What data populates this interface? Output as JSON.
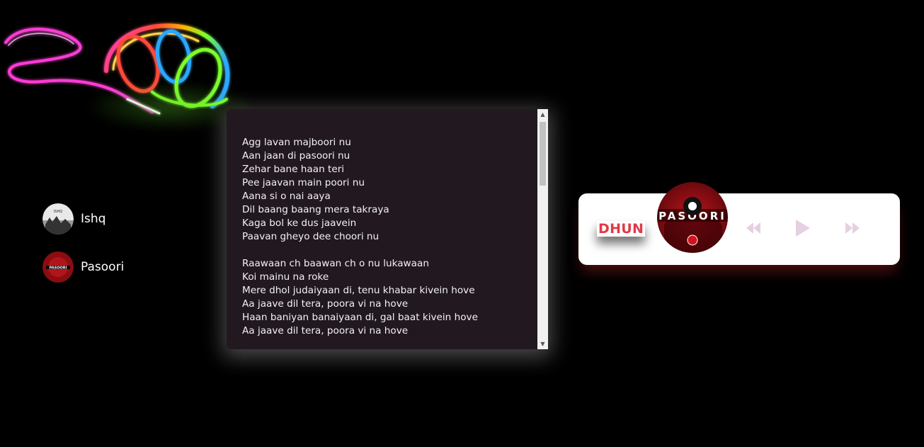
{
  "playlist": {
    "songs": [
      {
        "title": "Ishq",
        "cover": "ishq-cover"
      },
      {
        "title": "Pasoori",
        "cover": "pasoori-cover"
      }
    ]
  },
  "lyrics": {
    "text": "Agg lavan majboori nu\nAan jaan di pasoori nu\nZehar bane haan teri\nPee jaavan main poori nu\nAana si o nai aaya\nDil baang baang mera takraya\nKaga bol ke dus jaavein\nPaavan gheyo dee choori nu\n\nRaawaan ch baawan ch o nu lukawaan\nKoi mainu na roke\nMere dhol judaiyaan di, tenu khabar kivein hove\nAa jaave dil tera, poora vi na hove\nHaan baniyan banaiyaan di, gal baat kivein hove\nAa jaave dil tera, poora vi na hove"
  },
  "player": {
    "name": "DHUN",
    "disc_label": "PASOORI",
    "controls": {
      "prev_icon": "rewind-icon",
      "play_icon": "play-icon",
      "next_icon": "fast-forward-icon"
    }
  },
  "colors": {
    "background": "#000000",
    "lyrics_bg": "#221920",
    "accent": "#e03a48",
    "control": "#e6cfe3"
  }
}
